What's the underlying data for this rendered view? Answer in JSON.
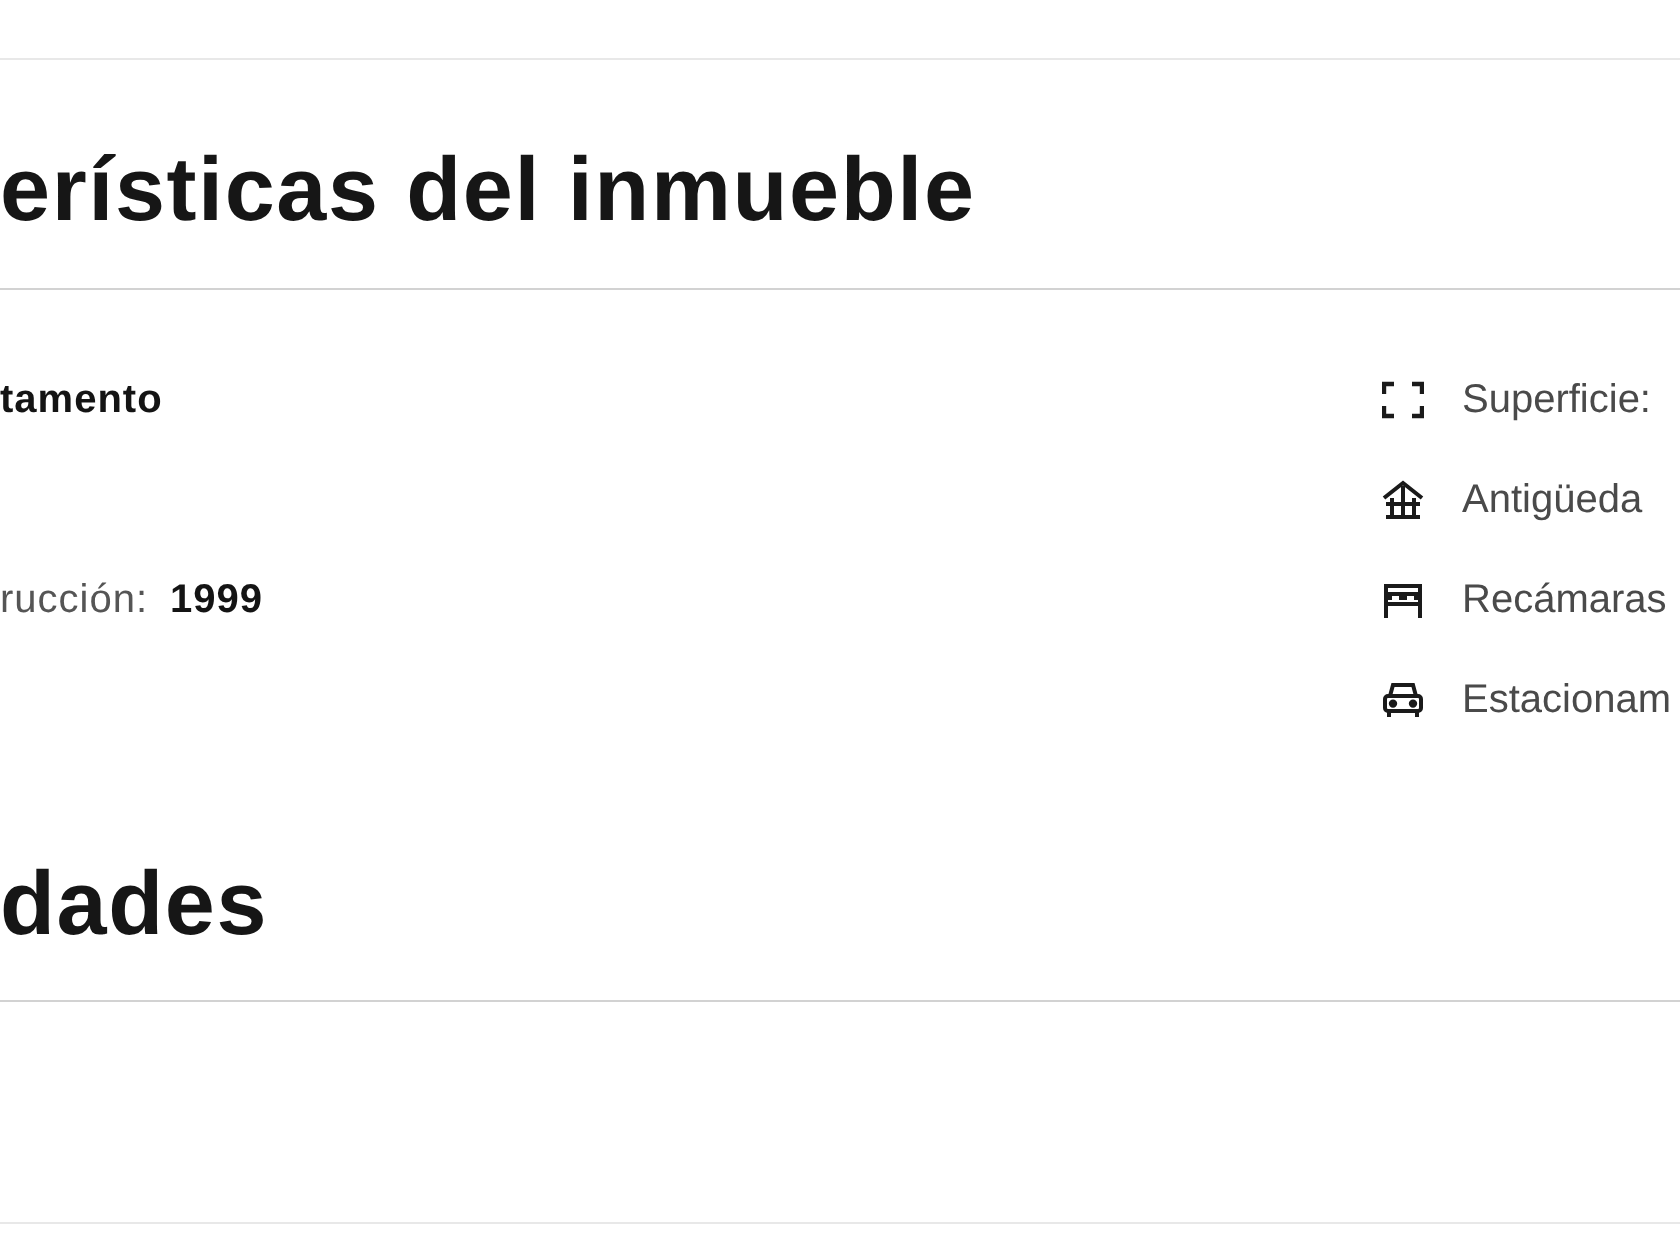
{
  "characteristics": {
    "title": "erísticas del inmueble",
    "details": [
      {
        "value": "tamento"
      },
      {
        "label": "rucción:",
        "value": "1999"
      }
    ],
    "features": [
      {
        "kind": "area",
        "label": "Superficie:"
      },
      {
        "kind": "age",
        "label": "Antigüeda"
      },
      {
        "kind": "bedrooms",
        "label": "Recámaras"
      },
      {
        "kind": "parking",
        "label": "Estacionam"
      }
    ]
  },
  "amenities": {
    "title": "dades"
  }
}
